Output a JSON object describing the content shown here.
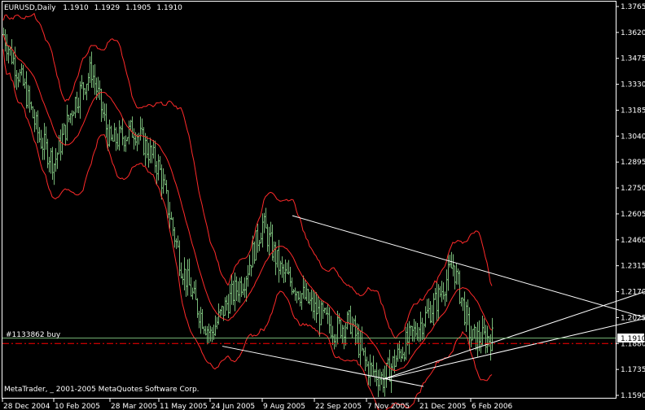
{
  "header": {
    "symbol": "EURUSD,Daily",
    "open": "1.1910",
    "high": "1.1929",
    "low": "1.1905",
    "close": "1.1910"
  },
  "order_label": "#1133862 buy",
  "watermark": "MetaTrader, _ 2001-2005 MetaQuotes Software Corp.",
  "price_tag": "1.1910",
  "colors": {
    "background": "#000000",
    "frame": "#ffffff",
    "candles": "#78b878",
    "bands": "#ff2a2a",
    "trendlines": "#ffffff",
    "bid_line": "#78b878",
    "order_line": "#ff0000"
  },
  "chart_data": {
    "type": "candlestick",
    "y_range": [
      1.159,
      1.3765
    ],
    "y_ticks": [
      "1.3765",
      "1.3620",
      "1.3475",
      "1.3330",
      "1.3185",
      "1.3040",
      "1.2895",
      "1.2750",
      "1.2605",
      "1.2460",
      "1.2315",
      "1.2170",
      "1.2025",
      "1.1880",
      "1.1735",
      "1.1590"
    ],
    "x_ticks": [
      "28 Dec 2004",
      "10 Feb 2005",
      "28 Mar 2005",
      "11 May 2005",
      "24 Jun 2005",
      "9 Aug 2005",
      "22 Sep 2005",
      "7 Nov 2005",
      "21 Dec 2005",
      "6 Feb 2006"
    ],
    "close_path": [
      [
        "28 Dec 2004",
        1.362
      ],
      [
        "10 Jan 2005",
        1.33
      ],
      [
        "24 Jan 2005",
        1.303
      ],
      [
        "10 Feb 2005",
        1.289
      ],
      [
        "1 Mar 2005",
        1.322
      ],
      [
        "14 Mar 2005",
        1.341
      ],
      [
        "28 Mar 2005",
        1.3
      ],
      [
        "18 Apr 2005",
        1.308
      ],
      [
        "11 May 2005",
        1.286
      ],
      [
        "27 May 2005",
        1.232
      ],
      [
        "10 Jun 2005",
        1.21
      ],
      [
        "24 Jun 2005",
        1.193
      ],
      [
        "11 Jul 2005",
        1.212
      ],
      [
        "27 Jul 2005",
        1.225
      ],
      [
        "9 Aug 2005",
        1.255
      ],
      [
        "26 Aug 2005",
        1.228
      ],
      [
        "9 Sep 2005",
        1.22
      ],
      [
        "22 Sep 2005",
        1.207
      ],
      [
        "10 Oct 2005",
        1.196
      ],
      [
        "24 Oct 2005",
        1.2
      ],
      [
        "7 Nov 2005",
        1.175
      ],
      [
        "21 Nov 2005",
        1.168
      ],
      [
        "5 Dec 2005",
        1.184
      ],
      [
        "21 Dec 2005",
        1.198
      ],
      [
        "6 Jan 2006",
        1.212
      ],
      [
        "20 Jan 2006",
        1.232
      ],
      [
        "6 Feb 2006",
        1.191
      ],
      [
        "15 Feb 2006",
        1.191
      ]
    ],
    "levels": {
      "bid": 1.191,
      "order_buy": 1.188
    },
    "trendlines": [
      {
        "from": [
          "9 Aug 2005",
          1.2595
        ],
        "to": [
          "right edge",
          1.2025
        ]
      },
      {
        "from": [
          "24 Jun 2005",
          1.1865
        ],
        "to": [
          "7 Nov 2005",
          1.164
        ]
      },
      {
        "from": [
          "7 Nov 2005",
          1.168
        ],
        "to": [
          "right edge",
          1.217
        ]
      },
      {
        "from": [
          "7 Nov 2005",
          1.168
        ],
        "to": [
          "right edge",
          1.202
        ]
      }
    ]
  }
}
